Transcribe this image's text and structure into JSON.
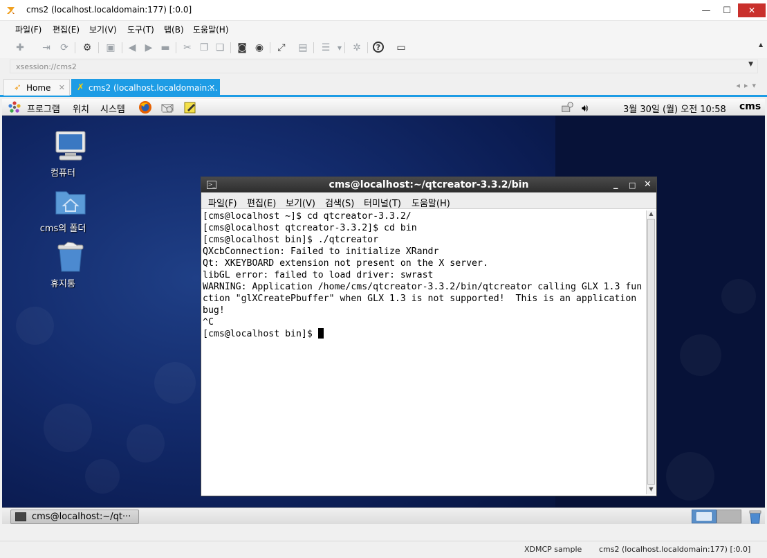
{
  "window": {
    "title": "cms2 (localhost.localdomain:177) [:0.0]",
    "minimize_glyph": "—",
    "maximize_glyph": "☐",
    "close_glyph": "✕"
  },
  "menu": [
    "파일(F)",
    "편집(E)",
    "보기(V)",
    "도구(T)",
    "탭(B)",
    "도움말(H)"
  ],
  "address": {
    "value": "xsession://cms2"
  },
  "tabs": [
    {
      "label": "Home",
      "active": false
    },
    {
      "label": "cms2 (localhost.localdomain:...",
      "active": true
    }
  ],
  "remote": {
    "panel": {
      "menus": [
        "프로그램",
        "위치",
        "시스템"
      ],
      "clock": "3월 30일 (월) 오전 10:58",
      "user": "cms"
    },
    "desktop_icons": [
      {
        "label": "컴퓨터",
        "icon": "computer-icon"
      },
      {
        "label": "cms의 폴더",
        "icon": "home-folder-icon"
      },
      {
        "label": "휴지통",
        "icon": "trash-icon"
      }
    ],
    "terminal": {
      "title": "cms@localhost:~/qtcreator-3.3.2/bin",
      "menu": [
        "파일(F)",
        "편집(E)",
        "보기(V)",
        "검색(S)",
        "터미널(T)",
        "도움말(H)"
      ],
      "lines": [
        "[cms@localhost ~]$ cd qtcreator-3.3.2/",
        "[cms@localhost qtcreator-3.3.2]$ cd bin",
        "[cms@localhost bin]$ ./qtcreator",
        "QXcbConnection: Failed to initialize XRandr",
        "Qt: XKEYBOARD extension not present on the X server.",
        "libGL error: failed to load driver: swrast",
        "WARNING: Application /home/cms/qtcreator-3.3.2/bin/qtcreator calling GLX 1.3 fun",
        "ction \"glXCreatePbuffer\" when GLX 1.3 is not supported!  This is an application",
        "bug!",
        "^C"
      ],
      "prompt": "[cms@localhost bin]$ "
    },
    "taskbar": {
      "task_label": "cms@localhost:~/qt···"
    }
  },
  "status": {
    "left": "XDMCP sample",
    "right": "cms2 (localhost.localdomain:177) [:0.0]"
  },
  "colors": {
    "accent": "#1d9ce5",
    "close": "#c9302c",
    "desktop": "#0a1b4e"
  }
}
